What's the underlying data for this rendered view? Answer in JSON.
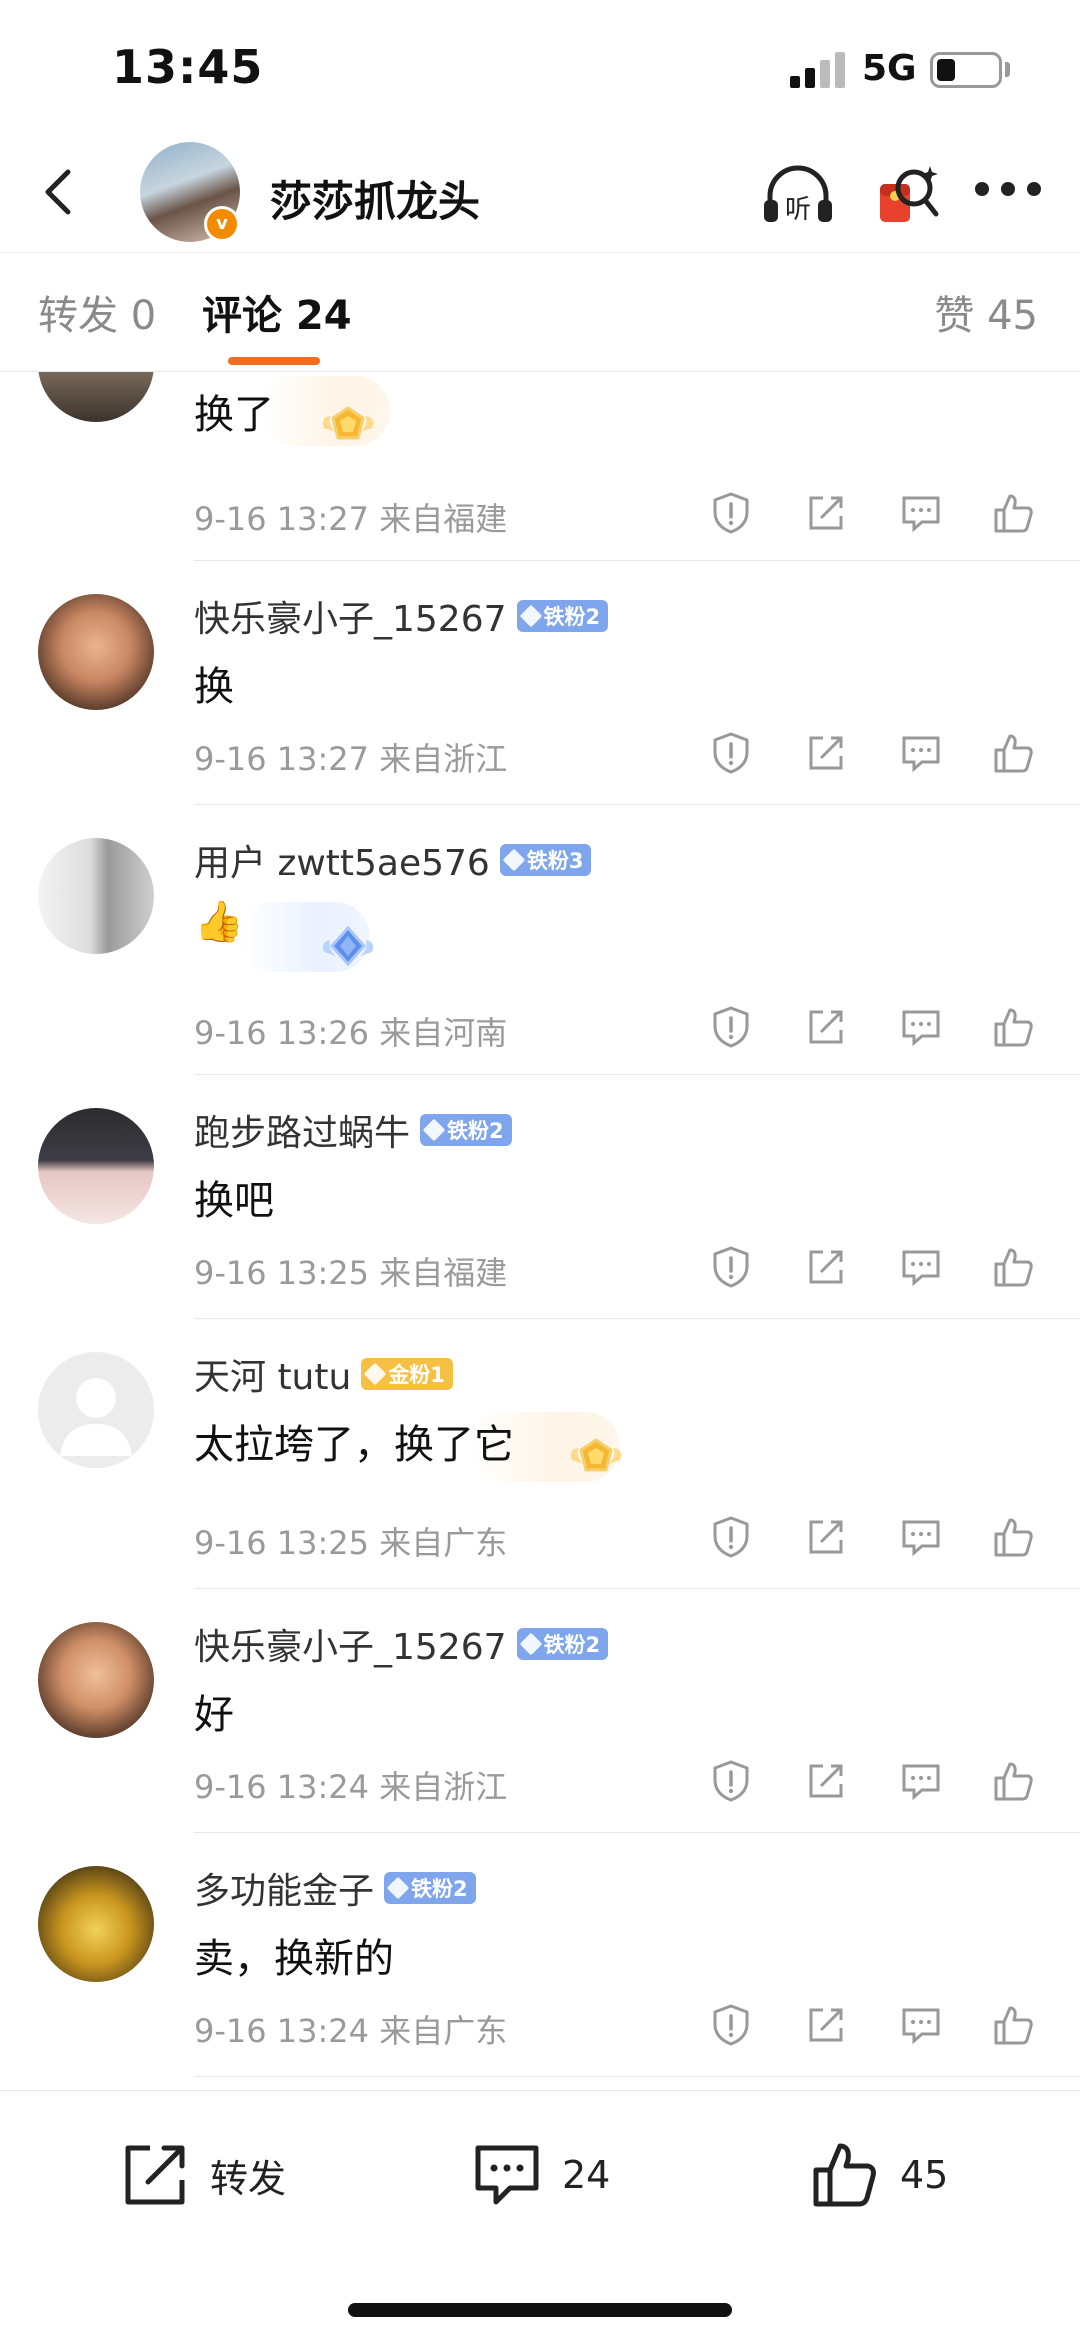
{
  "status_bar": {
    "time": "13:45",
    "network": "5G"
  },
  "header": {
    "title": "莎莎抓龙头",
    "listen_label": "听"
  },
  "tabs": {
    "repost": "转发 0",
    "comment": "评论 24",
    "like": "赞 45"
  },
  "comments": [
    {
      "name": "",
      "badge": "",
      "badge_type": "",
      "text": "换了",
      "meta": "9-16 13:27  来自福建",
      "deco": "gold"
    },
    {
      "name": "快乐豪小子_15267",
      "badge": "铁粉2",
      "badge_type": "iron",
      "text": "换",
      "meta": "9-16 13:27  来自浙江",
      "deco": ""
    },
    {
      "name": "用户 zwtt5ae576",
      "badge": "铁粉3",
      "badge_type": "iron",
      "text": "👍",
      "meta": "9-16 13:26  来自河南",
      "deco": "blue"
    },
    {
      "name": "跑步路过蜗牛",
      "badge": "铁粉2",
      "badge_type": "iron",
      "text": "换吧",
      "meta": "9-16 13:25  来自福建",
      "deco": ""
    },
    {
      "name": "天河 tutu",
      "badge": "金粉1",
      "badge_type": "gold",
      "text": "太拉垮了，换了它",
      "meta": "9-16 13:25  来自广东",
      "deco": "gold"
    },
    {
      "name": "快乐豪小子_15267",
      "badge": "铁粉2",
      "badge_type": "iron",
      "text": "好",
      "meta": "9-16 13:24  来自浙江",
      "deco": ""
    },
    {
      "name": "多功能金子",
      "badge": "铁粉2",
      "badge_type": "iron",
      "text": "卖，换新的",
      "meta": "9-16 13:24  来自广东",
      "deco": ""
    }
  ],
  "bottom_bar": {
    "repost_label": "转发",
    "comment_count": "24",
    "like_count": "45"
  },
  "colors": {
    "accent": "#f26d21",
    "iron_badge": "#7fa6ec",
    "gold_badge": "#f5c043",
    "meta_text": "#9a9a9a"
  }
}
